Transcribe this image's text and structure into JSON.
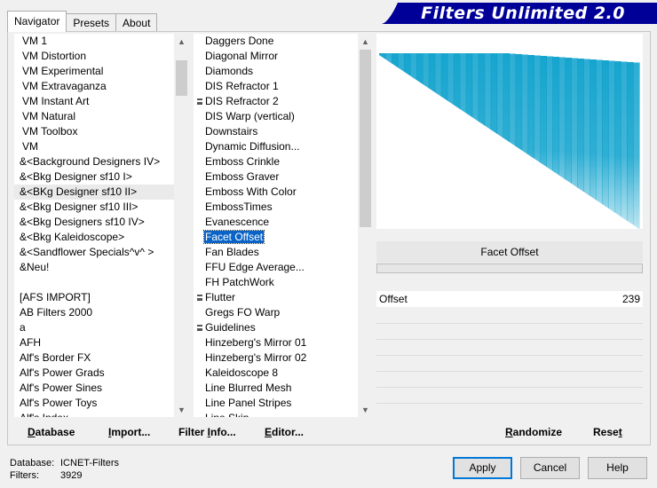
{
  "tabs": [
    "Navigator",
    "Presets",
    "About"
  ],
  "banner": {
    "title": "Filters Unlimited 2.0",
    "color": "#000099"
  },
  "categories": [
    {
      "label": "VM 1",
      "vm": true
    },
    {
      "label": "VM Distortion",
      "vm": true
    },
    {
      "label": "VM Experimental",
      "vm": true
    },
    {
      "label": "VM Extravaganza",
      "vm": true
    },
    {
      "label": "VM Instant Art",
      "vm": true
    },
    {
      "label": "VM Natural",
      "vm": true
    },
    {
      "label": "VM Toolbox",
      "vm": true
    },
    {
      "label": "VM",
      "vm": true
    },
    {
      "label": "&<Background Designers IV>"
    },
    {
      "label": "&<Bkg Designer sf10 I>"
    },
    {
      "label": "&<BKg Designer sf10 II>",
      "highlighted": true
    },
    {
      "label": "&<Bkg Designer sf10 III>"
    },
    {
      "label": "&<Bkg Designers sf10 IV>"
    },
    {
      "label": "&<Bkg Kaleidoscope>"
    },
    {
      "label": "&<Sandflower Specials^v^ >"
    },
    {
      "label": "&Neu!"
    },
    {
      "label": ""
    },
    {
      "label": "[AFS IMPORT]"
    },
    {
      "label": "AB Filters 2000"
    },
    {
      "label": "a"
    },
    {
      "label": "AFH"
    },
    {
      "label": "Alf's Border FX"
    },
    {
      "label": "Alf's Power Grads"
    },
    {
      "label": "Alf's Power Sines"
    },
    {
      "label": "Alf's Power Toys"
    },
    {
      "label": "Alf's Index"
    }
  ],
  "filters": [
    {
      "label": "Daggers Done"
    },
    {
      "label": "Diagonal Mirror"
    },
    {
      "label": "Diamonds"
    },
    {
      "label": "DIS Refractor 1"
    },
    {
      "label": "DIS Refractor 2",
      "marked": true
    },
    {
      "label": "DIS Warp (vertical)"
    },
    {
      "label": "Downstairs"
    },
    {
      "label": "Dynamic Diffusion..."
    },
    {
      "label": "Emboss Crinkle"
    },
    {
      "label": "Emboss Graver"
    },
    {
      "label": "Emboss With Color"
    },
    {
      "label": "EmbossTimes"
    },
    {
      "label": "Evanescence"
    },
    {
      "label": "Facet Offset",
      "selected": true
    },
    {
      "label": "Fan Blades"
    },
    {
      "label": "FFU Edge Average..."
    },
    {
      "label": "FH PatchWork"
    },
    {
      "label": "Flutter",
      "marked": true
    },
    {
      "label": "Gregs FO Warp"
    },
    {
      "label": "Guidelines",
      "marked": true
    },
    {
      "label": "Hinzeberg's Mirror 01"
    },
    {
      "label": "Hinzeberg's Mirror 02"
    },
    {
      "label": "Kaleidoscope 8"
    },
    {
      "label": "Line Blurred Mesh"
    },
    {
      "label": "Line Panel Stripes"
    },
    {
      "label": "Line Skin"
    }
  ],
  "preview": {
    "color": "#0aa0cc",
    "filter_name": "Facet Offset"
  },
  "params": {
    "name": "Offset",
    "value": "239"
  },
  "links": {
    "database": "Database",
    "import": "Import...",
    "filter_info": "Filter Info...",
    "editor": "Editor...",
    "randomize": "Randomize",
    "reset": "Reset"
  },
  "status": {
    "database_label": "Database:",
    "database_value": "ICNET-Filters",
    "filters_label": "Filters:",
    "filters_value": "3929"
  },
  "buttons": {
    "apply": "Apply",
    "cancel": "Cancel",
    "help": "Help"
  }
}
